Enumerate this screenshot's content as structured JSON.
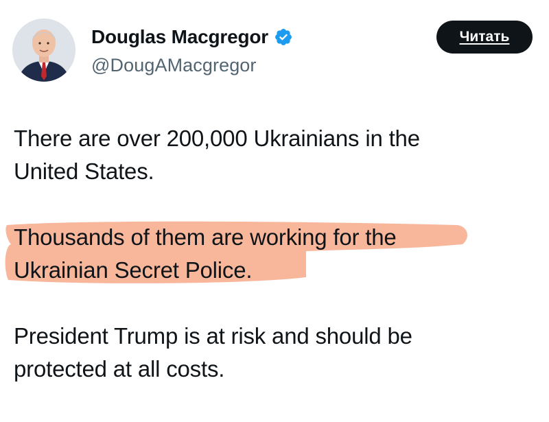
{
  "author": {
    "display_name": "Douglas Macgregor",
    "handle": "@DougAMacgregor",
    "verified": true,
    "avatar_icon": "profile-photo-icon"
  },
  "follow_button": {
    "label": "Читать"
  },
  "tweet": {
    "paragraphs": [
      {
        "lines": [
          "There are over 200,000 Ukrainians in the",
          "United States."
        ],
        "highlighted": false
      },
      {
        "lines": [
          "Thousands of them are working for the",
          "Ukrainian Secret Police."
        ],
        "highlighted": true
      },
      {
        "lines": [
          "President Trump is at risk and should be",
          "protected at all costs."
        ],
        "highlighted": false
      }
    ]
  },
  "colors": {
    "highlight": "#f7a98a",
    "verified_badge": "#1d9bf0",
    "button_bg": "#0f1419",
    "handle_text": "#536471"
  }
}
